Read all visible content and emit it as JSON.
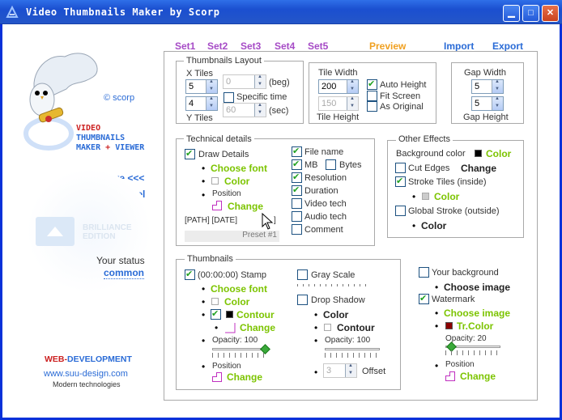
{
  "window": {
    "title": "Video Thumbnails Maker by Scorp"
  },
  "tabs": {
    "set1": "Set1",
    "set2": "Set2",
    "set3": "Set3",
    "set4": "Set4",
    "set5": "Set5",
    "preview": "Preview",
    "import": "Import",
    "export": "Export"
  },
  "brand": {
    "copyright": "© scorp",
    "line1": "VIDEO",
    "line2": "THUMBNAILS",
    "line3a": "MAKER",
    "line3b": "+",
    "line3c": "VIEWER",
    "save": "Save <<<",
    "cancel": "Cancel",
    "edition1": "BRILLIANCE",
    "edition2": "EDITION",
    "status_label": "Your status",
    "status_value": "common",
    "web1": "WEB-",
    "web2": "DEVELOPMENT",
    "url": "www.suu-design.com",
    "tagline": "Modern technologies"
  },
  "layout": {
    "title": "Thumbnails Layout",
    "x_tiles": "X Tiles",
    "x_val": "5",
    "y_val": "4",
    "y_tiles": "Y Tiles",
    "beg_val": "0",
    "beg": "(beg)",
    "specific": "Specific time",
    "sec_val": "60",
    "sec": "(sec)"
  },
  "tile": {
    "width_label": "Tile Width",
    "width_val": "200",
    "height_val": "150",
    "height_label": "Tile Height",
    "auto_height": "Auto Height",
    "fit_screen": "Fit Screen",
    "as_original": "As Original"
  },
  "gap": {
    "width_label": "Gap Width",
    "w_val": "5",
    "h_val": "5",
    "height_label": "Gap Height"
  },
  "tech": {
    "title": "Technical details",
    "draw": "Draw Details",
    "choose_font": "Choose font",
    "color": "Color",
    "position": "Position",
    "change": "Change",
    "path_line": "[PATH] [DATE]",
    "bracket": "]",
    "preset": "Preset #1",
    "file_name": "File name",
    "mb": "MB",
    "bytes": "Bytes",
    "resolution": "Resolution",
    "duration": "Duration",
    "video_tech": "Video tech",
    "audio_tech": "Audio tech",
    "comment": "Comment"
  },
  "effects": {
    "title": "Other  Effects",
    "bg_color": "Background color",
    "color": "Color",
    "cut_edges": "Cut Edges",
    "change": "Change",
    "stroke_tiles": "Stroke Tiles (inside)",
    "stroke_color": "Color",
    "global_stroke": "Global Stroke (outside)",
    "global_color": "Color"
  },
  "thumbs": {
    "title": "Thumbnails",
    "stamp": "(00:00:00) Stamp",
    "choose_font": "Choose font",
    "color": "Color",
    "contour": "Contour",
    "change": "Change",
    "opacity": "Opacity: 100",
    "position": "Position",
    "change2": "Change",
    "gray": "Gray Scale",
    "drop": "Drop Shadow",
    "ds_color": "Color",
    "ds_contour": "Contour",
    "ds_opacity": "Opacity: 100",
    "offset_val": "3",
    "offset": "Offset"
  },
  "bg": {
    "your_bg": "Your background",
    "choose_image": "Choose image",
    "watermark": "Watermark",
    "wm_choose": "Choose image",
    "tr_color": "Tr.Color",
    "opacity": "Opacity: 20",
    "position": "Position",
    "change": "Change"
  },
  "colors": {
    "titlebar": "#2456c8",
    "green": "#7cc400",
    "purple": "#a64bc6",
    "orange": "#f0a020",
    "blue": "#2a6bd6",
    "red": "#cc2020"
  }
}
